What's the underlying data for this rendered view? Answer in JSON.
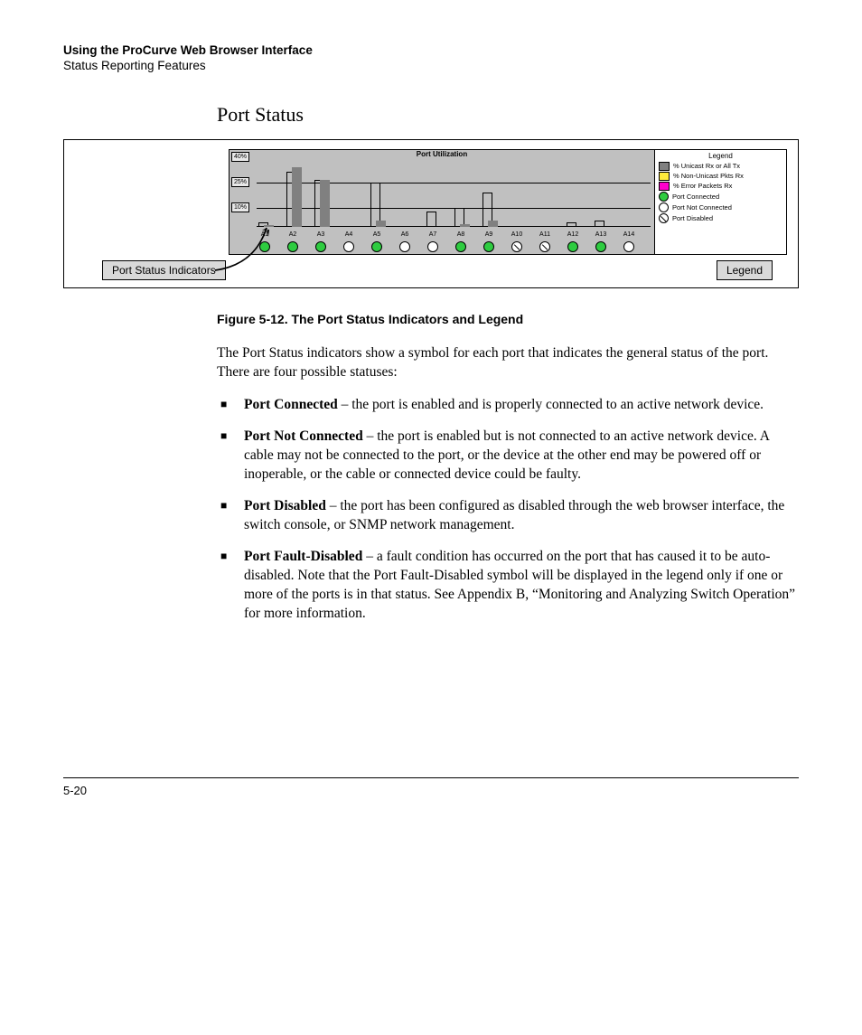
{
  "header": {
    "title": "Using the ProCurve Web Browser Interface",
    "subtitle": "Status Reporting Features"
  },
  "section_title": "Port Status",
  "figure_caption": "Figure 5-12.  The Port Status Indicators and Legend",
  "callouts": {
    "left": "Port Status Indicators",
    "right": "Legend"
  },
  "intro": "The Port Status indicators show a symbol for each port that indicates the general status of the port. There are four possible statuses:",
  "statuses": [
    {
      "term": "Port Connected",
      "desc": " – the port is enabled and is properly connected to an active network device."
    },
    {
      "term": "Port Not Connected",
      "desc": " – the port is enabled but is not connected to an active network device. A cable may not be connected to the port, or the device at the other end may be powered off or inoperable, or the cable or connected device could be faulty."
    },
    {
      "term": "Port Disabled",
      "desc": " – the port has been configured as disabled through the web browser interface, the switch console, or SNMP network manage­ment."
    },
    {
      "term": "Port Fault-Disabled",
      "desc": " – a fault condition has occurred on the port that has caused it to be auto-disabled. Note that the Port Fault-Disabled symbol will be displayed in the legend only if one or more of the ports is in that status. See Appendix B, “Monitoring and Analyzing Switch Opera­tion” for more information."
    }
  ],
  "page_number": "5-20",
  "chart_data": {
    "type": "bar",
    "title": "Port Utilization",
    "ylabel": "%",
    "ylim": [
      0,
      40
    ],
    "y_ticks": [
      "40%",
      "25%",
      "10%"
    ],
    "categories": [
      "A1",
      "A2",
      "A3",
      "A4",
      "A5",
      "A6",
      "A7",
      "A8",
      "A9",
      "A10",
      "A11",
      "A12",
      "A13",
      "A14"
    ],
    "series": [
      {
        "name": "% Unicast Rx or All Tx (filled)",
        "values": [
          1,
          38,
          30,
          0,
          4,
          0,
          0,
          2,
          4,
          0,
          0,
          0,
          0,
          0
        ]
      },
      {
        "name": "Outline bar",
        "values": [
          3,
          35,
          30,
          0,
          28,
          0,
          10,
          12,
          22,
          0,
          0,
          3,
          4,
          0
        ]
      }
    ],
    "port_status": [
      "connected",
      "connected",
      "connected",
      "notconn",
      "connected",
      "notconn",
      "notconn",
      "connected",
      "connected",
      "disabled",
      "disabled",
      "connected",
      "connected",
      "notconn"
    ],
    "legend": {
      "title": "Legend",
      "items": [
        {
          "swatch": "gray",
          "label": "% Unicast Rx or All Tx"
        },
        {
          "swatch": "yellow",
          "label": "% Non-Unicast Pkts Rx"
        },
        {
          "swatch": "mag",
          "label": "% Error Packets Rx"
        },
        {
          "dot": "green",
          "label": "Port Connected"
        },
        {
          "dot": "white",
          "label": "Port Not Connected"
        },
        {
          "dot": "white",
          "slash": true,
          "label": "Port Disabled"
        }
      ]
    }
  }
}
